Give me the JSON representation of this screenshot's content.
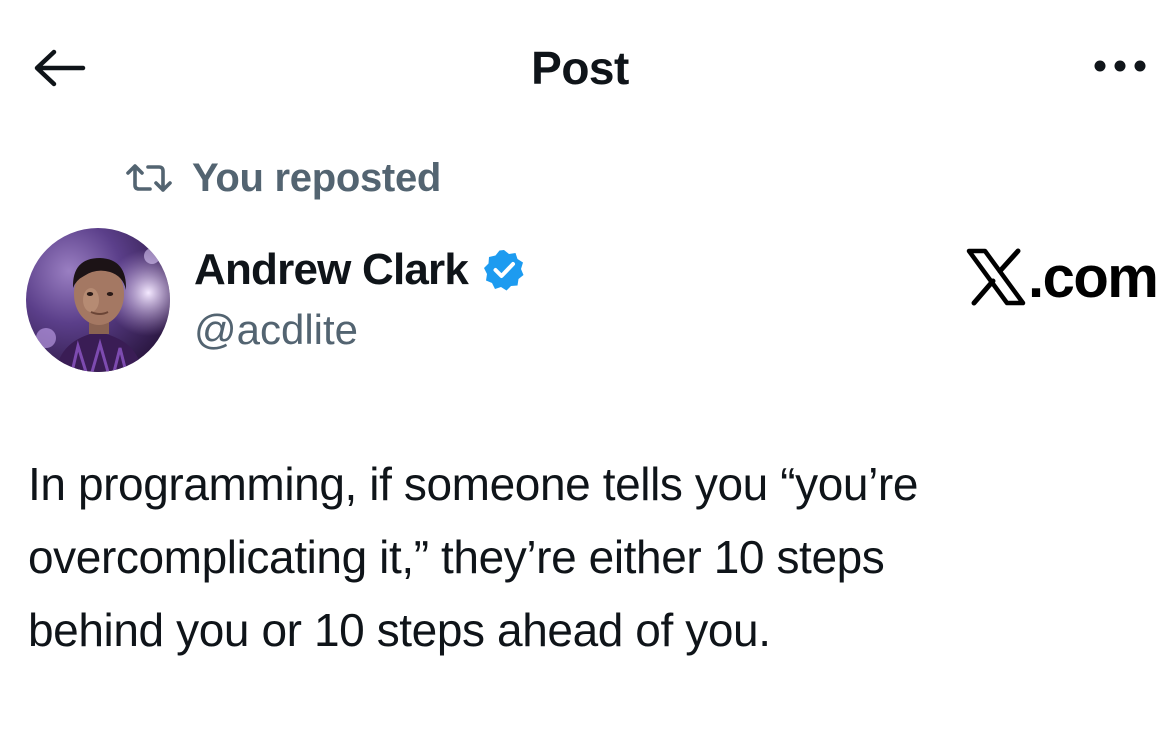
{
  "header": {
    "title": "Post",
    "back_icon": "arrow-left-icon",
    "more_icon": "more-horizontal-icon"
  },
  "repost": {
    "icon": "repost-icon",
    "label": "You reposted"
  },
  "author": {
    "name": "Andrew Clark",
    "handle": "@acdlite",
    "verified": true,
    "verified_color": "#1d9bf0"
  },
  "site_mark": {
    "text": ".com"
  },
  "post": {
    "lines": [
      "In programming, if someone tells you “you’re",
      "overcomplicating it,” they’re either 10 steps",
      "behind you or 10 steps ahead of you."
    ]
  },
  "colors": {
    "text_primary": "#0f1419",
    "text_secondary": "#536471",
    "accent": "#1d9bf0",
    "background": "#ffffff"
  }
}
